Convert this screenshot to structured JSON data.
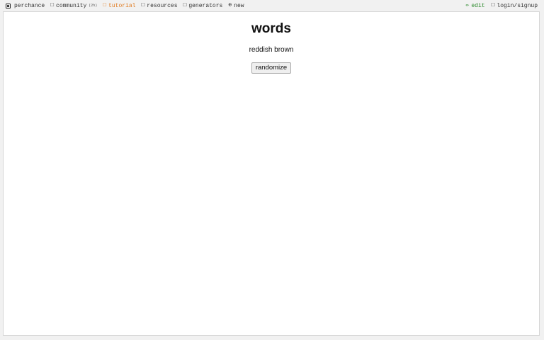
{
  "nav": {
    "left": [
      {
        "label": "perchance",
        "icon": "dice-icon"
      },
      {
        "label": "community",
        "icon": "chat-icon",
        "count": "(2h)"
      },
      {
        "label": "tutorial",
        "icon": "book-icon"
      },
      {
        "label": "resources",
        "icon": "folder-icon"
      },
      {
        "label": "generators",
        "icon": "list-icon"
      },
      {
        "label": "new",
        "icon": "plus-circle-icon",
        "glyph": "⊕"
      }
    ],
    "right": [
      {
        "label": "edit",
        "icon": "pencil-icon",
        "glyph": "✏"
      },
      {
        "label": "login/signup",
        "icon": "user-icon"
      }
    ]
  },
  "page": {
    "title": "words",
    "output": "reddish brown",
    "button_label": "randomize"
  },
  "colors": {
    "tutorial": "#e07a1f",
    "edit": "#2e8b2e",
    "background": "#f1f1f1",
    "panel": "#ffffff"
  }
}
